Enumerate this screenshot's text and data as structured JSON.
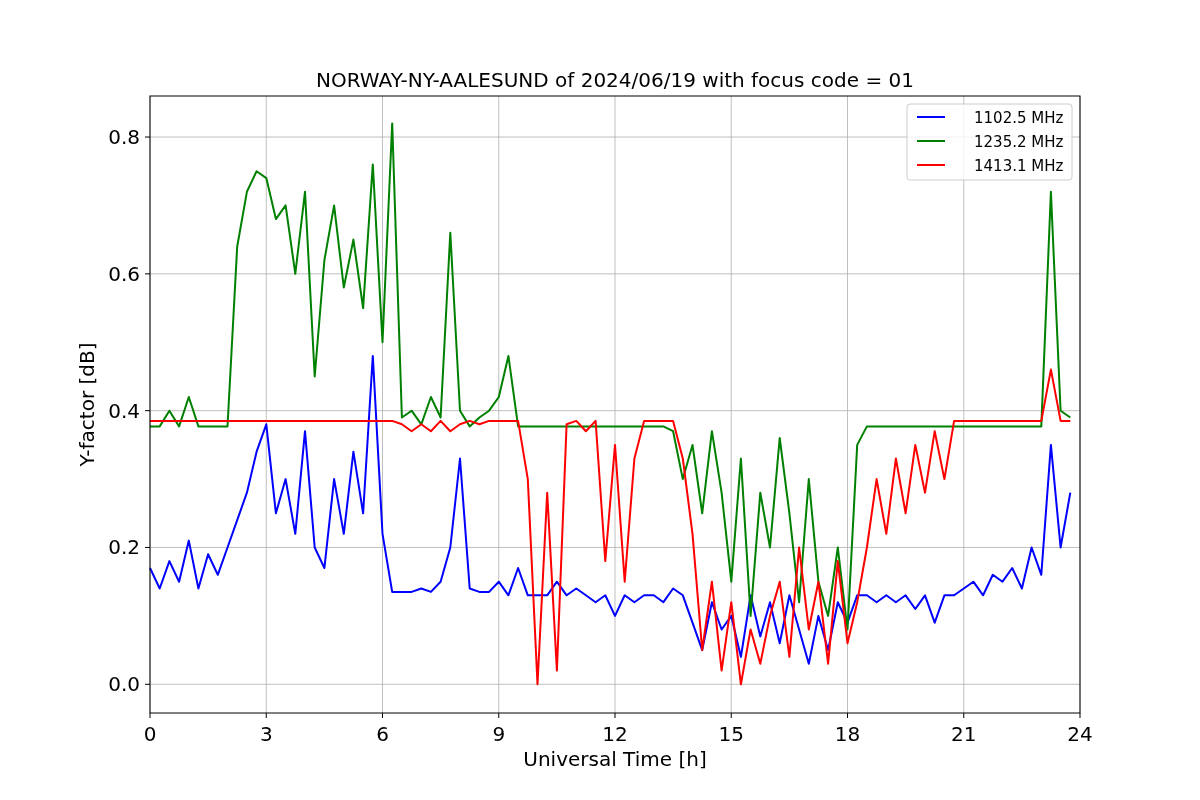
{
  "figure": {
    "chart_data": {
      "type": "line",
      "title": "NORWAY-NY-AALESUND of 2024/06/19 with focus code = 01",
      "xlabel": "Universal Time [h]",
      "ylabel": "Y-factor [dB]",
      "grid": true,
      "legend": true,
      "xlim": [
        0,
        24
      ],
      "ylim": [
        -0.042,
        0.86
      ],
      "xticks": [
        0,
        3,
        6,
        9,
        12,
        15,
        18,
        21,
        24
      ],
      "yticks": [
        {
          "value": 0,
          "label": "0.0"
        },
        {
          "value": 0.2,
          "label": "0.2"
        },
        {
          "value": 0.4,
          "label": "0.4"
        },
        {
          "value": 0.6,
          "label": "0.6"
        },
        {
          "value": 0.8,
          "label": "0.8"
        }
      ],
      "x": [
        0,
        0.25,
        0.5,
        0.75,
        1,
        1.25,
        1.5,
        1.75,
        2,
        2.25,
        2.5,
        2.75,
        3,
        3.25,
        3.5,
        3.75,
        4,
        4.25,
        4.5,
        4.75,
        5,
        5.25,
        5.5,
        5.75,
        6,
        6.25,
        6.5,
        6.75,
        7,
        7.25,
        7.5,
        7.75,
        8,
        8.25,
        8.5,
        8.75,
        9,
        9.25,
        9.5,
        9.75,
        10,
        10.25,
        10.5,
        10.75,
        11,
        11.25,
        11.5,
        11.75,
        12,
        12.25,
        12.5,
        12.75,
        13,
        13.25,
        13.5,
        13.75,
        14,
        14.25,
        14.5,
        14.75,
        15,
        15.25,
        15.5,
        15.75,
        16,
        16.25,
        16.5,
        16.75,
        17,
        17.25,
        17.5,
        17.75,
        18,
        18.25,
        18.5,
        18.75,
        19,
        19.25,
        19.5,
        19.75,
        20,
        20.25,
        20.5,
        20.75,
        21,
        21.25,
        21.5,
        21.75,
        22,
        22.25,
        22.5,
        22.75,
        23,
        23.25,
        23.5,
        23.75
      ],
      "series": [
        {
          "name": "1102.5 MHz",
          "color": "#0000ff",
          "values": [
            0.17,
            0.14,
            0.18,
            0.15,
            0.21,
            0.14,
            0.19,
            0.16,
            0.2,
            0.24,
            0.28,
            0.34,
            0.38,
            0.25,
            0.3,
            0.22,
            0.37,
            0.2,
            0.17,
            0.3,
            0.22,
            0.34,
            0.25,
            0.48,
            0.22,
            0.135,
            0.135,
            0.135,
            0.14,
            0.135,
            0.15,
            0.2,
            0.33,
            0.14,
            0.135,
            0.135,
            0.15,
            0.13,
            0.17,
            0.13,
            0.13,
            0.13,
            0.15,
            0.13,
            0.14,
            0.13,
            0.12,
            0.13,
            0.1,
            0.13,
            0.12,
            0.13,
            0.13,
            0.12,
            0.14,
            0.13,
            0.09,
            0.05,
            0.12,
            0.08,
            0.1,
            0.04,
            0.13,
            0.07,
            0.12,
            0.06,
            0.13,
            0.08,
            0.03,
            0.1,
            0.05,
            0.12,
            0.09,
            0.13,
            0.13,
            0.12,
            0.13,
            0.12,
            0.13,
            0.11,
            0.13,
            0.09,
            0.13,
            0.13,
            0.14,
            0.15,
            0.13,
            0.16,
            0.15,
            0.17,
            0.14,
            0.2,
            0.16,
            0.35,
            0.2,
            0.28
          ]
        },
        {
          "name": "1235.2 MHz",
          "color": "#008000",
          "values": [
            0.377,
            0.377,
            0.4,
            0.377,
            0.42,
            0.377,
            0.377,
            0.377,
            0.377,
            0.64,
            0.72,
            0.75,
            0.74,
            0.68,
            0.7,
            0.6,
            0.72,
            0.45,
            0.62,
            0.7,
            0.58,
            0.65,
            0.55,
            0.76,
            0.5,
            0.82,
            0.39,
            0.4,
            0.38,
            0.42,
            0.39,
            0.66,
            0.4,
            0.377,
            0.39,
            0.4,
            0.42,
            0.48,
            0.377,
            0.377,
            0.377,
            0.377,
            0.377,
            0.377,
            0.377,
            0.377,
            0.377,
            0.377,
            0.377,
            0.377,
            0.377,
            0.377,
            0.377,
            0.377,
            0.37,
            0.3,
            0.35,
            0.25,
            0.37,
            0.28,
            0.15,
            0.33,
            0.1,
            0.28,
            0.2,
            0.36,
            0.25,
            0.12,
            0.3,
            0.15,
            0.1,
            0.2,
            0.08,
            0.35,
            0.377,
            0.377,
            0.377,
            0.377,
            0.377,
            0.377,
            0.377,
            0.377,
            0.377,
            0.377,
            0.377,
            0.377,
            0.377,
            0.377,
            0.377,
            0.377,
            0.377,
            0.377,
            0.377,
            0.72,
            0.4,
            0.39
          ]
        },
        {
          "name": "1413.1 MHz",
          "color": "#ff0000",
          "values": [
            0.385,
            0.385,
            0.385,
            0.385,
            0.385,
            0.385,
            0.385,
            0.385,
            0.385,
            0.385,
            0.385,
            0.385,
            0.385,
            0.385,
            0.385,
            0.385,
            0.385,
            0.385,
            0.385,
            0.385,
            0.385,
            0.385,
            0.385,
            0.385,
            0.385,
            0.385,
            0.38,
            0.37,
            0.38,
            0.37,
            0.385,
            0.37,
            0.38,
            0.385,
            0.38,
            0.385,
            0.385,
            0.385,
            0.385,
            0.3,
            0.0,
            0.28,
            0.02,
            0.38,
            0.385,
            0.37,
            0.385,
            0.18,
            0.35,
            0.15,
            0.33,
            0.385,
            0.385,
            0.385,
            0.385,
            0.33,
            0.22,
            0.05,
            0.15,
            0.02,
            0.12,
            0.0,
            0.08,
            0.03,
            0.1,
            0.15,
            0.04,
            0.2,
            0.08,
            0.15,
            0.03,
            0.18,
            0.06,
            0.12,
            0.2,
            0.3,
            0.22,
            0.33,
            0.25,
            0.35,
            0.28,
            0.37,
            0.3,
            0.385,
            0.385,
            0.385,
            0.385,
            0.385,
            0.385,
            0.385,
            0.385,
            0.385,
            0.385,
            0.46,
            0.385,
            0.385
          ]
        }
      ]
    }
  }
}
